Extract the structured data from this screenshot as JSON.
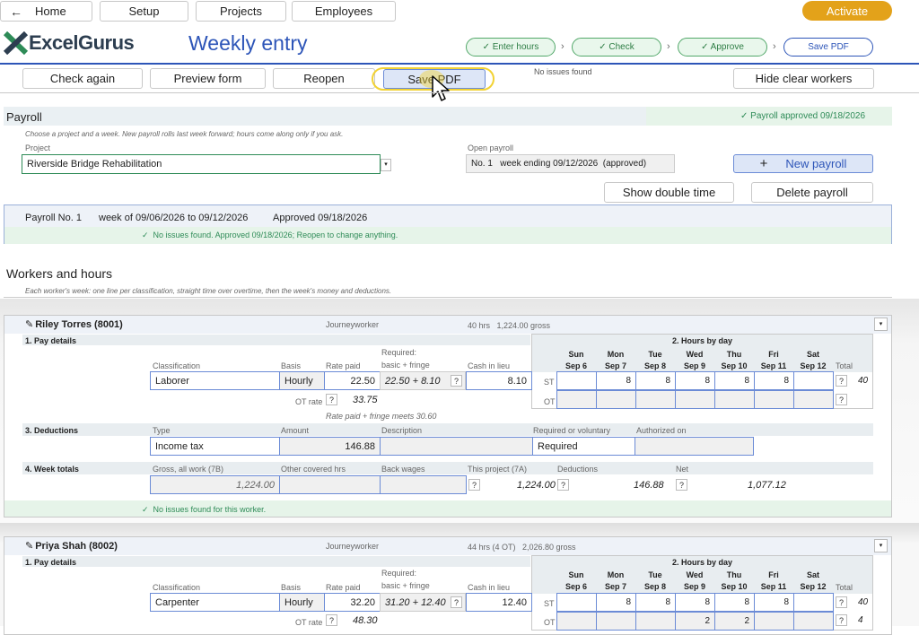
{
  "nav": {
    "home": "Home",
    "setup": "Setup",
    "projects": "Projects",
    "employees": "Employees",
    "activate": "Activate"
  },
  "brand": {
    "logo": "ExcelGurus",
    "page_title": "Weekly entry"
  },
  "steps": [
    "✓ Enter hours",
    "✓ Check",
    "✓ Approve",
    "Save PDF"
  ],
  "toolbar": {
    "check_again": "Check again",
    "preview_form": "Preview form",
    "reopen": "Reopen",
    "save_pdf": "Save PDF",
    "status": "No issues found",
    "hide_clear": "Hide clear workers"
  },
  "payroll": {
    "heading": "Payroll",
    "approved_badge": "✓ Payroll approved 09/18/2026",
    "hint": "Choose a project and a week. New payroll rolls last week forward; hours come along only if you ask.",
    "project_label": "Project",
    "project_value": "Riverside Bridge Rehabilitation",
    "open_label": "Open payroll",
    "open_value": "No. 1   week ending 09/12/2026  (approved)",
    "new_payroll": "New payroll",
    "show_double": "Show double time",
    "delete_payroll": "Delete payroll"
  },
  "summary": {
    "number": "Payroll No. 1",
    "week": "week of 09/06/2026 to 09/12/2026",
    "approved": "Approved 09/18/2026",
    "status": "✓  No issues found. Approved 09/18/2026; Reopen to change anything."
  },
  "workers_section": {
    "heading": "Workers and hours",
    "hint": "Each worker's week: one line per classification, straight time over overtime, then the week's money and deductions."
  },
  "labels": {
    "pay_details": "1. Pay details",
    "hours_by_day": "2. Hours by day",
    "deductions": "3. Deductions",
    "week_totals": "4. Week totals",
    "classification": "Classification",
    "basis": "Basis",
    "rate_paid": "Rate paid",
    "required": "Required:",
    "basic_fringe": "basic + fringe",
    "cash_lieu": "Cash in lieu",
    "total": "Total",
    "st": "ST",
    "ot": "OT",
    "ot_rate": "OT rate",
    "type": "Type",
    "amount": "Amount",
    "description": "Description",
    "req_vol": "Required or voluntary",
    "authorized": "Authorized on",
    "gross_all": "Gross, all work (7B)",
    "other_hrs": "Other covered hrs",
    "back_wages": "Back wages",
    "this_project": "This project (7A)",
    "ded": "Deductions",
    "net": "Net",
    "q": "?"
  },
  "days": [
    {
      "d": "Sun",
      "dt": "Sep 6"
    },
    {
      "d": "Mon",
      "dt": "Sep 7"
    },
    {
      "d": "Tue",
      "dt": "Sep 8"
    },
    {
      "d": "Wed",
      "dt": "Sep 9"
    },
    {
      "d": "Thu",
      "dt": "Sep 10"
    },
    {
      "d": "Fri",
      "dt": "Sep 11"
    },
    {
      "d": "Sat",
      "dt": "Sep 12"
    }
  ],
  "workers": [
    {
      "name": "Riley Torres (8001)",
      "trade": "Journeyworker",
      "hours_gross": "40 hrs   1,224.00 gross",
      "classification": "Laborer",
      "basis": "Hourly",
      "rate": "22.50",
      "required": "22.50 + 8.10",
      "cash": "8.10",
      "ot_rate": "33.75",
      "rate_note": "Rate paid + fringe meets 30.60",
      "st": [
        "",
        "8",
        "8",
        "8",
        "8",
        "8",
        ""
      ],
      "st_total": "40",
      "ot": [
        "",
        "",
        "",
        "",
        "",
        "",
        ""
      ],
      "ot_total": "",
      "ded_type": "Income tax",
      "ded_amount": "146.88",
      "ded_desc": "",
      "ded_req": "Required",
      "ded_auth": "",
      "gross": "1,224.00",
      "other_hrs": "",
      "back": "",
      "this_project": "1,224.00",
      "deductions": "146.88",
      "net": "1,077.12",
      "status": "✓  No issues found for this worker."
    },
    {
      "name": "Priya Shah (8002)",
      "trade": "Journeyworker",
      "hours_gross": "44 hrs (4 OT)   2,026.80 gross",
      "classification": "Carpenter",
      "basis": "Hourly",
      "rate": "32.20",
      "required": "31.20 + 12.40",
      "cash": "12.40",
      "ot_rate": "48.30",
      "st": [
        "",
        "8",
        "8",
        "8",
        "8",
        "8",
        ""
      ],
      "st_total": "40",
      "ot": [
        "",
        "",
        "",
        "2",
        "2",
        "",
        ""
      ],
      "ot_total": "4"
    }
  ],
  "colors": {
    "accent": "#2d55b8",
    "activate": "#e3a21a",
    "ok": "#2e8b57",
    "highlight": "#f2d233"
  }
}
